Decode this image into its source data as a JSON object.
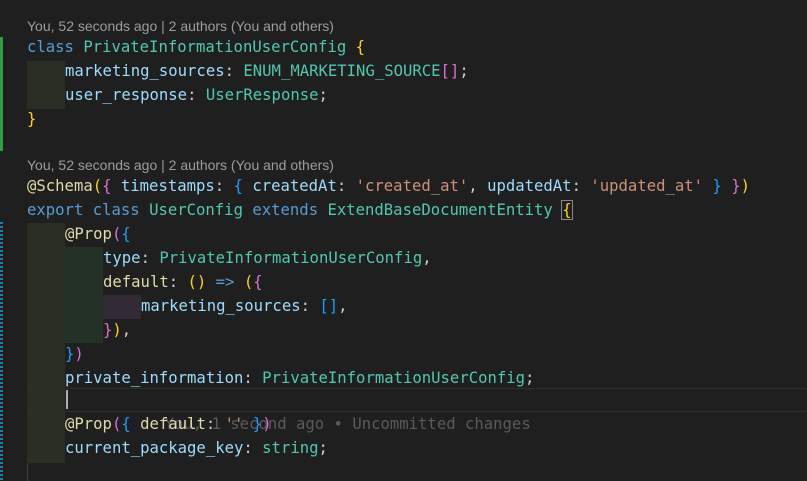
{
  "editor": {
    "colors": {
      "background": "#1f1f1f",
      "added_gutter": "#2ea043",
      "modified_gutter": "#1b81a8",
      "keyword": "#569cd6",
      "class_name": "#4ec9b0",
      "function": "#dcdcaa",
      "property": "#9cdcfe",
      "string": "#ce9178",
      "bracket_level1": "#ffd700",
      "bracket_level2": "#da70d6",
      "bracket_level3": "#179fff"
    },
    "codelens": [
      "You, 52 seconds ago | 2 authors (You and others)",
      "You, 52 seconds ago | 2 authors (You and others)"
    ],
    "blame_inline": "You, 1 second ago • Uncommitted changes",
    "lines": [
      [
        [
          "k",
          "class"
        ],
        [
          "p",
          " "
        ],
        [
          "cls",
          "PrivateInformationUserConfig"
        ],
        [
          "p",
          " "
        ],
        [
          "b1",
          "{"
        ]
      ],
      [
        [
          "prop",
          "marketing_sources"
        ],
        [
          "p",
          ": "
        ],
        [
          "cls",
          "ENUM_MARKETING_SOURCE"
        ],
        [
          "b2",
          "[]"
        ],
        [
          "p",
          ";"
        ]
      ],
      [
        [
          "prop",
          "user_response"
        ],
        [
          "p",
          ": "
        ],
        [
          "cls",
          "UserResponse"
        ],
        [
          "p",
          ";"
        ]
      ],
      [
        [
          "b1",
          "}"
        ]
      ],
      [
        [
          "fn",
          "@Schema"
        ],
        [
          "b1",
          "("
        ],
        [
          "b2",
          "{"
        ],
        [
          "p",
          " "
        ],
        [
          "prop",
          "timestamps"
        ],
        [
          "p",
          ": "
        ],
        [
          "b3",
          "{"
        ],
        [
          "p",
          " "
        ],
        [
          "prop",
          "createdAt"
        ],
        [
          "p",
          ": "
        ],
        [
          "str",
          "'created_at'"
        ],
        [
          "p",
          ", "
        ],
        [
          "prop",
          "updatedAt"
        ],
        [
          "p",
          ": "
        ],
        [
          "str",
          "'updated_at'"
        ],
        [
          "p",
          " "
        ],
        [
          "b3",
          "}"
        ],
        [
          "p",
          " "
        ],
        [
          "b2",
          "}"
        ],
        [
          "b1",
          ")"
        ]
      ],
      [
        [
          "k",
          "export"
        ],
        [
          "p",
          " "
        ],
        [
          "k",
          "class"
        ],
        [
          "p",
          " "
        ],
        [
          "cls",
          "UserConfig"
        ],
        [
          "p",
          " "
        ],
        [
          "k",
          "extends"
        ],
        [
          "p",
          " "
        ],
        [
          "cls",
          "ExtendBaseDocumentEntity"
        ],
        [
          "p",
          " "
        ],
        [
          "b1",
          "{"
        ]
      ],
      [
        [
          "fn",
          "@Prop"
        ],
        [
          "b2",
          "("
        ],
        [
          "b3",
          "{"
        ]
      ],
      [
        [
          "prop",
          "type"
        ],
        [
          "p",
          ": "
        ],
        [
          "cls",
          "PrivateInformationUserConfig"
        ],
        [
          "p",
          ","
        ]
      ],
      [
        [
          "fn",
          "default"
        ],
        [
          "p",
          ": "
        ],
        [
          "b1",
          "()"
        ],
        [
          "p",
          " "
        ],
        [
          "k",
          "=>"
        ],
        [
          "p",
          " "
        ],
        [
          "b1",
          "("
        ],
        [
          "b2",
          "{"
        ]
      ],
      [
        [
          "prop",
          "marketing_sources"
        ],
        [
          "p",
          ": "
        ],
        [
          "b3",
          "[]"
        ],
        [
          "p",
          ","
        ]
      ],
      [
        [
          "b2",
          "}"
        ],
        [
          "b1",
          ")"
        ],
        [
          "p",
          ","
        ]
      ],
      [
        [
          "b3",
          "}"
        ],
        [
          "b2",
          ")"
        ]
      ],
      [
        [
          "prop",
          "private_information"
        ],
        [
          "p",
          ": "
        ],
        [
          "cls",
          "PrivateInformationUserConfig"
        ],
        [
          "p",
          ";"
        ]
      ],
      [],
      [
        [
          "fn",
          "@Prop"
        ],
        [
          "b2",
          "("
        ],
        [
          "b3",
          "{"
        ],
        [
          "p",
          " "
        ],
        [
          "fn",
          "default"
        ],
        [
          "p",
          ": "
        ],
        [
          "str",
          "''"
        ],
        [
          "p",
          " "
        ],
        [
          "b3",
          "}"
        ],
        [
          "b2",
          ")"
        ]
      ],
      [
        [
          "prop",
          "current_package_key"
        ],
        [
          "p",
          ": "
        ],
        [
          "cls",
          "string"
        ],
        [
          "p",
          ";"
        ]
      ]
    ]
  }
}
